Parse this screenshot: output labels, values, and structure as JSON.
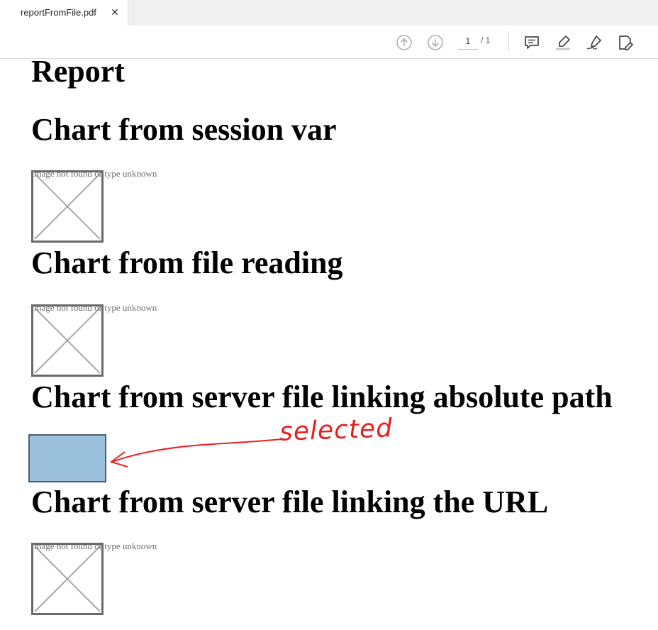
{
  "tab": {
    "title": "reportFromFile.pdf",
    "close_icon": "close-icon"
  },
  "toolbar": {
    "page_current": "1",
    "page_total": "/ 1",
    "icons": [
      "previous-page-icon",
      "next-page-icon",
      "comment-icon",
      "highlight-icon",
      "sign-icon",
      "edit-pdf-icon"
    ]
  },
  "document": {
    "title": "Report",
    "sections": [
      {
        "heading": "Chart from session var",
        "image_alt": "Image not found or type unknown"
      },
      {
        "heading": "Chart from file reading",
        "image_alt": "Image not found or type unknown"
      },
      {
        "heading": "Chart from server file linking absolute path",
        "image_state": "selected"
      },
      {
        "heading": "Chart from server file linking the URL",
        "image_alt": "Image not found or type unknown"
      }
    ]
  },
  "annotation": {
    "text": "selected",
    "color": "#e82020"
  },
  "colors": {
    "selection_fill": "#9cc1dc",
    "selection_border": "#4f5f6e"
  }
}
